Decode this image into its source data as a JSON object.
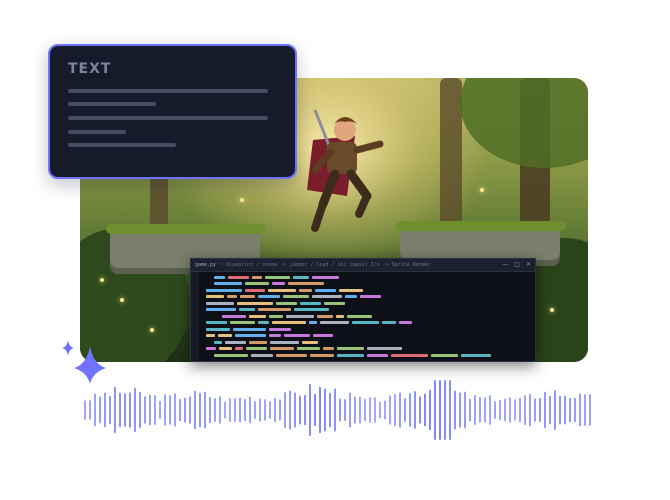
{
  "text_card": {
    "title": "TEXT"
  },
  "editor": {
    "tab": "game.py",
    "path": "~ blueprint / scene -> jumper / load / ini (main) 2/n -> Sprite Render",
    "window_buttons": [
      "—",
      "□",
      "✕"
    ]
  },
  "colors": {
    "card_bg": "#161b2b",
    "card_border": "#6f73ff",
    "wave_color": "#7d86ff",
    "sparkle_color": "#6f73ff",
    "editor_bg": "#0d1117"
  },
  "icons": {
    "sparkle": "sparkle-icon",
    "window_minimize": "minimize-icon",
    "window_maximize": "maximize-icon",
    "window_close": "close-icon"
  }
}
